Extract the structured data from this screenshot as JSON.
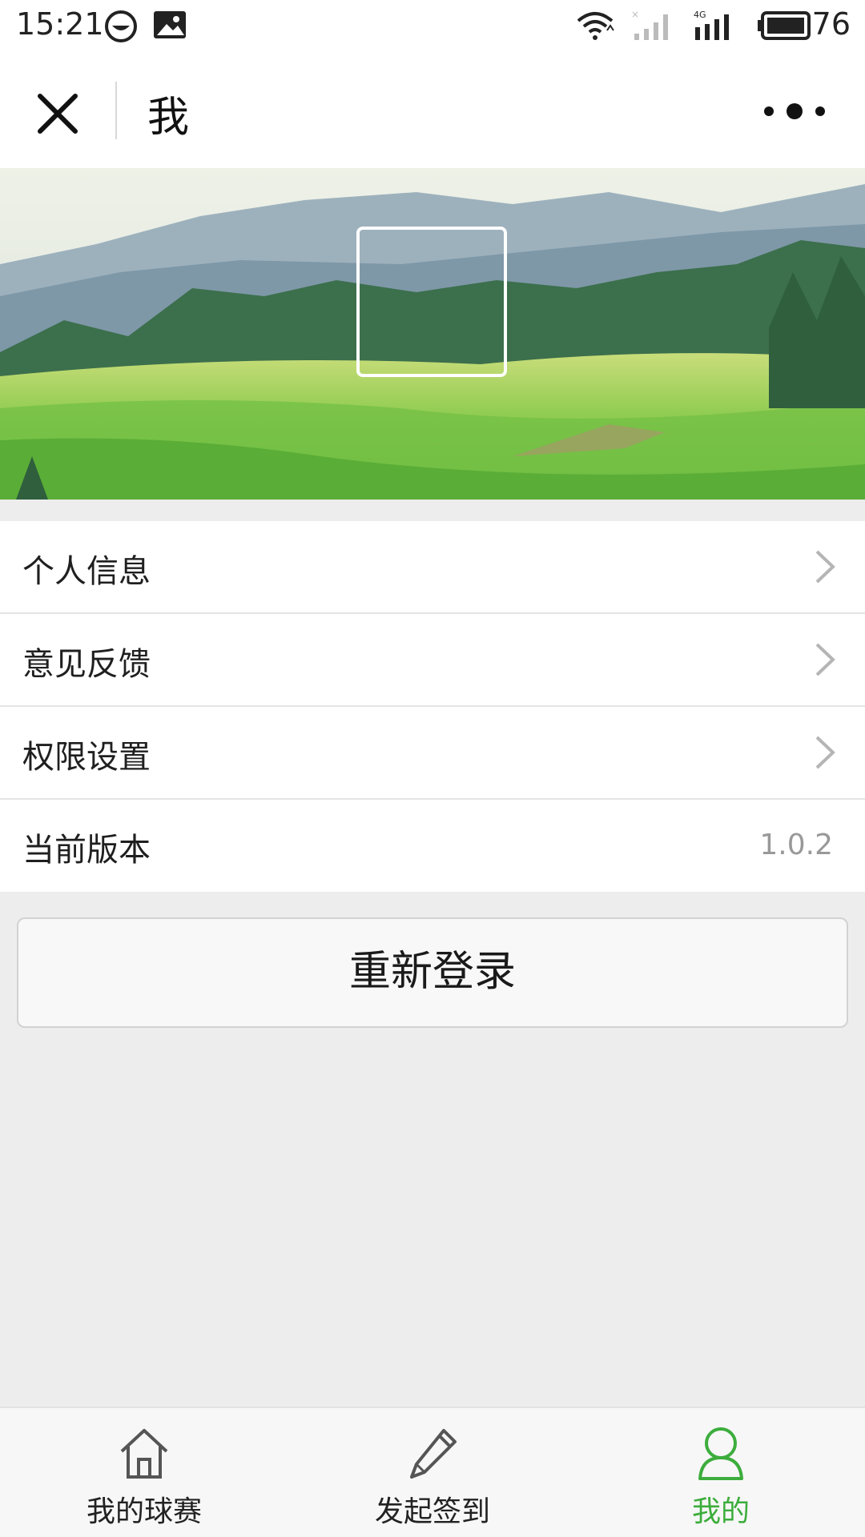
{
  "status_bar": {
    "time": "15:21",
    "battery": "76",
    "network": "4G"
  },
  "header": {
    "title": "我",
    "close_icon": "close-icon",
    "more_icon": "more-icon"
  },
  "menu": {
    "items": [
      {
        "label": "个人信息",
        "icon": "chevron-right-icon"
      },
      {
        "label": "意见反馈",
        "icon": "chevron-right-icon"
      },
      {
        "label": "权限设置",
        "icon": "chevron-right-icon"
      },
      {
        "label": "当前版本",
        "value": "1.0.2"
      }
    ]
  },
  "relogin_label": "重新登录",
  "tabbar": {
    "tabs": [
      {
        "label": "我的球赛",
        "icon": "home-icon"
      },
      {
        "label": "发起签到",
        "icon": "pencil-icon"
      },
      {
        "label": "我的",
        "icon": "user-icon",
        "active": true
      }
    ],
    "active_color": "#3cad3c"
  }
}
